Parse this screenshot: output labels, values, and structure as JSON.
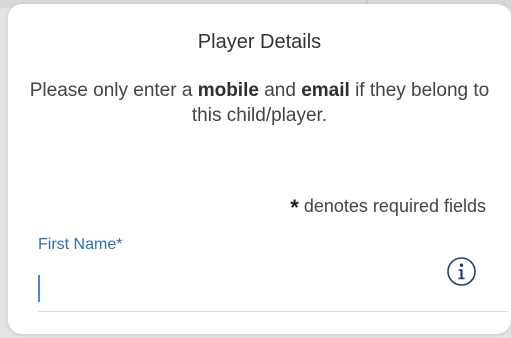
{
  "modal": {
    "title": "Player Details",
    "instruction": {
      "prefix": "Please only enter a ",
      "mobile": "mobile",
      "middle": " and ",
      "email": "email",
      "suffix": " if they belong to this child/player."
    },
    "required_note": {
      "symbol": "*",
      "text": "denotes required fields"
    },
    "first_name_field": {
      "label": "First Name*",
      "value": "",
      "info_icon": "info-circle-icon"
    }
  },
  "colors": {
    "label_blue": "#2f6fb5",
    "caret_blue": "#4a86d6",
    "icon_navy": "#1f3f7a"
  }
}
